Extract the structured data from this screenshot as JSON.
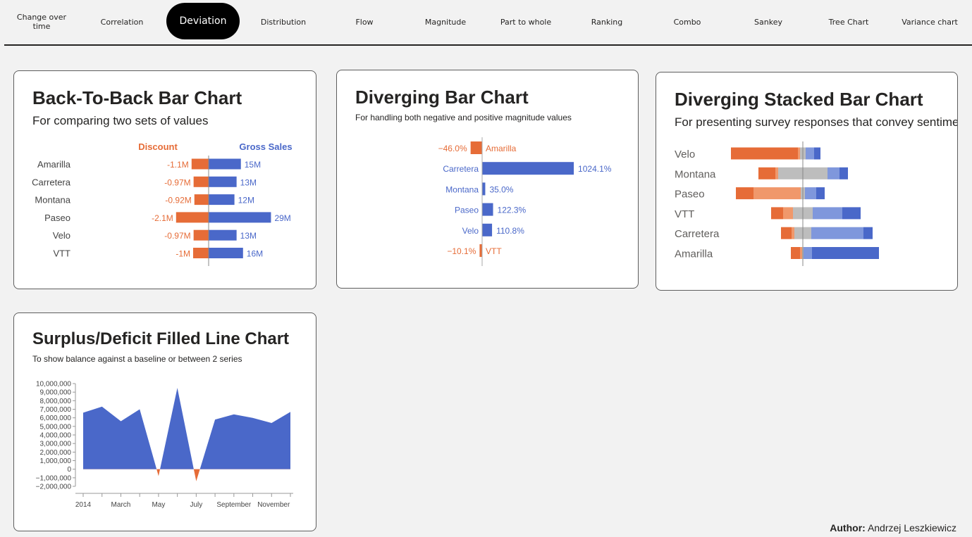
{
  "nav": {
    "items": [
      {
        "label": "Change over time",
        "name": "tab-change-over-time"
      },
      {
        "label": "Correlation",
        "name": "tab-correlation"
      },
      {
        "label": "Deviation",
        "name": "tab-deviation",
        "active": true
      },
      {
        "label": "Distribution",
        "name": "tab-distribution"
      },
      {
        "label": "Flow",
        "name": "tab-flow"
      },
      {
        "label": "Magnitude",
        "name": "tab-magnitude"
      },
      {
        "label": "Part to whole",
        "name": "tab-part-to-whole"
      },
      {
        "label": "Ranking",
        "name": "tab-ranking"
      },
      {
        "label": "Combo",
        "name": "tab-combo"
      },
      {
        "label": "Sankey",
        "name": "tab-sankey"
      },
      {
        "label": "Tree Chart",
        "name": "tab-tree-chart"
      },
      {
        "label": "Variance chart",
        "name": "tab-variance-chart"
      }
    ]
  },
  "colors": {
    "orange": "#e66c37",
    "light_orange": "#f0986b",
    "blue": "#4a68c9",
    "light_blue": "#7f97dc",
    "gray": "#bdbdbd"
  },
  "cards": {
    "back_to_back": {
      "title": "Back-To-Back Bar Chart",
      "subtitle": "For comparing two sets of values"
    },
    "diverging": {
      "title": "Diverging Bar Chart",
      "subtitle": "For handling both negative and positive magnitude values"
    },
    "diverging_stacked": {
      "title": "Diverging Stacked Bar Chart",
      "subtitle": "For presenting survey responses that convey sentiment"
    },
    "surplus": {
      "title": "Surplus/Deficit Filled Line Chart",
      "subtitle": "To show balance against a baseline or between 2 series"
    }
  },
  "author": {
    "label": "Author:",
    "name": "Andrzej Leszkiewicz"
  },
  "chart_data": [
    {
      "type": "bar",
      "id": "back_to_back",
      "series": [
        {
          "name": "Discount",
          "values": [
            -1.1,
            -0.97,
            -0.92,
            -2.1,
            -0.97,
            -1.0
          ],
          "labels": [
            "-1.1M",
            "-0.97M",
            "-0.92M",
            "-2.1M",
            "-0.97M",
            "-1M"
          ]
        },
        {
          "name": "Gross Sales",
          "values": [
            15,
            13,
            12,
            29,
            13,
            16
          ],
          "labels": [
            "15M",
            "13M",
            "12M",
            "29M",
            "13M",
            "16M"
          ]
        }
      ],
      "categories": [
        "Amarilla",
        "Carretera",
        "Montana",
        "Paseo",
        "Velo",
        "VTT"
      ]
    },
    {
      "type": "bar",
      "id": "diverging",
      "categories": [
        "Amarilla",
        "Carretera",
        "Montana",
        "Paseo",
        "Velo",
        "VTT"
      ],
      "values": [
        -46.0,
        1024.1,
        35.0,
        122.3,
        110.8,
        -10.1
      ],
      "labels": [
        "−46.0%",
        "1024.1%",
        "35.0%",
        "122.3%",
        "110.8%",
        "−10.1%"
      ]
    },
    {
      "type": "bar",
      "id": "diverging_stacked",
      "categories": [
        "Velo",
        "Montana",
        "Paseo",
        "VTT",
        "Carretera",
        "Amarilla"
      ],
      "segments": [
        [
          {
            "c": "orange",
            "v": -95
          },
          {
            "c": "light_orange",
            "v": -3
          },
          {
            "c": "gray",
            "v": 8
          },
          {
            "c": "light_blue",
            "v": 12
          },
          {
            "c": "blue",
            "v": 9
          }
        ],
        [
          {
            "c": "orange",
            "v": -24
          },
          {
            "c": "light_orange",
            "v": -4
          },
          {
            "c": "gray",
            "v": 70
          },
          {
            "c": "light_blue",
            "v": 17
          },
          {
            "c": "blue",
            "v": 12
          }
        ],
        [
          {
            "c": "orange",
            "v": -25
          },
          {
            "c": "light_orange",
            "v": -67
          },
          {
            "c": "gray",
            "v": 6
          },
          {
            "c": "light_blue",
            "v": 16
          },
          {
            "c": "blue",
            "v": 12
          }
        ],
        [
          {
            "c": "orange",
            "v": -17
          },
          {
            "c": "light_orange",
            "v": -14
          },
          {
            "c": "gray",
            "v": 28
          },
          {
            "c": "light_blue",
            "v": 42
          },
          {
            "c": "blue",
            "v": 26
          }
        ],
        [
          {
            "c": "orange",
            "v": -15
          },
          {
            "c": "light_orange",
            "v": -4
          },
          {
            "c": "gray",
            "v": 24
          },
          {
            "c": "light_blue",
            "v": 74
          },
          {
            "c": "blue",
            "v": 13
          }
        ],
        [
          {
            "c": "orange",
            "v": -13
          },
          {
            "c": "light_orange",
            "v": -3
          },
          {
            "c": "gray",
            "v": 2
          },
          {
            "c": "light_blue",
            "v": 12
          },
          {
            "c": "blue",
            "v": 95
          }
        ]
      ]
    },
    {
      "type": "area",
      "id": "surplus",
      "x": [
        "2014-01",
        "2014-02",
        "2014-03",
        "2014-04",
        "2014-05",
        "2014-06",
        "2014-07",
        "2014-08",
        "2014-09",
        "2014-10",
        "2014-11",
        "2014-12"
      ],
      "values": [
        6600000,
        7300000,
        5600000,
        7000000,
        -800000,
        9500000,
        -1400000,
        5800000,
        6400000,
        6000000,
        5400000,
        6700000
      ],
      "ylim": [
        -2000000,
        10000000
      ],
      "yticks": [
        "10,000,000",
        "9,000,000",
        "8,000,000",
        "7,000,000",
        "6,000,000",
        "5,000,000",
        "4,000,000",
        "3,000,000",
        "2,000,000",
        "1,000,000",
        "0",
        "−1,000,000",
        "−2,000,000"
      ],
      "xtick_labels": [
        "2014",
        "March",
        "May",
        "July",
        "September",
        "November"
      ]
    }
  ]
}
